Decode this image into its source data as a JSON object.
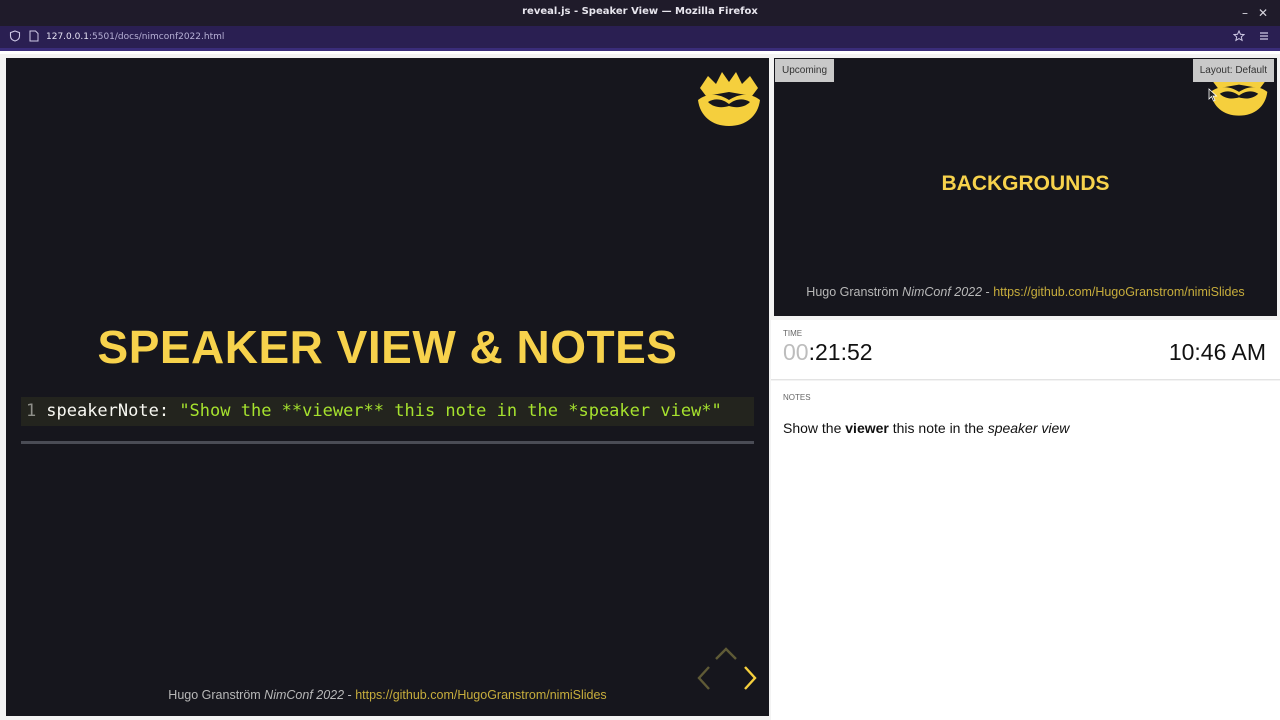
{
  "window": {
    "title": "reveal.js - Speaker View — Mozilla Firefox"
  },
  "urlbar": {
    "host": "127.0.0.1",
    "rest": ":5501/docs/nimconf2022.html"
  },
  "current_slide": {
    "heading": "SPEAKER VIEW & NOTES",
    "code": {
      "line_number": "1",
      "key": "speakerNote: ",
      "string": "\"Show the **viewer** this note in the *speaker view*\""
    },
    "footer": {
      "author": "Hugo Granström ",
      "event": "NimConf 2022",
      "sep": " - ",
      "link": "https://github.com/HugoGranstrom/nimiSlides"
    }
  },
  "upcoming_slide": {
    "label": "Upcoming",
    "layout_button": "Layout: Default",
    "heading": "BACKGROUNDS",
    "footer": {
      "author": "Hugo Granström ",
      "event": "NimConf 2022",
      "sep": " - ",
      "link": "https://github.com/HugoGranstrom/nimiSlides"
    }
  },
  "timer": {
    "label": "TIME",
    "elapsed_hours": "00",
    "elapsed_rest": ":21:52",
    "clock": "10:46 AM"
  },
  "notes": {
    "label": "NOTES",
    "part1": "Show the ",
    "bold": "viewer",
    "part2": " this note in the ",
    "italic": "speaker view"
  },
  "colors": {
    "accent": "#f7d24c",
    "slide_bg": "#16161d",
    "link": "#c7ad3c",
    "code_string": "#a6e22e"
  },
  "icons": [
    "shield-icon",
    "page-icon",
    "star-icon",
    "menu-icon",
    "crown-logo",
    "chevron-up-icon",
    "chevron-left-icon",
    "chevron-right-icon",
    "cursor-icon"
  ]
}
